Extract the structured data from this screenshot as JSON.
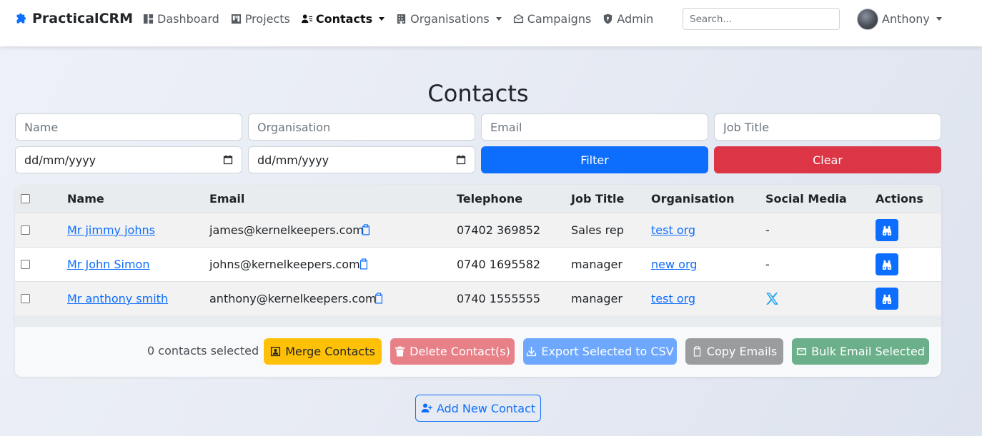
{
  "brand": {
    "name": "PracticalCRM",
    "color": "#0d6efd"
  },
  "nav": {
    "items": [
      {
        "label": "Dashboard",
        "icon": "dashboard-icon",
        "active": false,
        "dropdown": false
      },
      {
        "label": "Projects",
        "icon": "kanban-icon",
        "active": false,
        "dropdown": false
      },
      {
        "label": "Contacts",
        "icon": "contacts-icon",
        "active": true,
        "dropdown": true
      },
      {
        "label": "Organisations",
        "icon": "building-icon",
        "active": false,
        "dropdown": true
      },
      {
        "label": "Campaigns",
        "icon": "envelope-icon",
        "active": false,
        "dropdown": false
      },
      {
        "label": "Admin",
        "icon": "shield-icon",
        "active": false,
        "dropdown": false
      }
    ],
    "search_placeholder": "Search...",
    "user_name": "Anthony"
  },
  "page": {
    "title": "Contacts"
  },
  "filters": {
    "name_placeholder": "Name",
    "organisation_placeholder": "Organisation",
    "email_placeholder": "Email",
    "job_title_placeholder": "Job Title",
    "date_from": "dd/mm/yyyy",
    "date_to": "dd/mm/yyyy",
    "filter_label": "Filter",
    "clear_label": "Clear"
  },
  "table": {
    "headers": [
      "Name",
      "Email",
      "Telephone",
      "Job Title",
      "Organisation",
      "Social Media",
      "Actions"
    ],
    "rows": [
      {
        "name": "Mr jimmy johns",
        "email": "james@kernelkeepers.com",
        "telephone": "07402 369852",
        "job_title": "Sales rep",
        "organisation": "test org",
        "social": "-"
      },
      {
        "name": "Mr John Simon",
        "email": "johns@kernelkeepers.com",
        "telephone": "0740 1695582",
        "job_title": "manager",
        "organisation": "new org",
        "social": "-"
      },
      {
        "name": "Mr anthony smith",
        "email": "anthony@kernelkeepers.com",
        "telephone": "0740 1555555",
        "job_title": "manager",
        "organisation": "test org",
        "social": "x-icon"
      }
    ]
  },
  "bulk": {
    "selected_text": "0 contacts selected",
    "merge_label": "Merge Contacts",
    "delete_label": "Delete Contact(s)",
    "export_label": "Export Selected to CSV",
    "copy_label": "Copy Emails",
    "bulk_email_label": "Bulk Email Selected"
  },
  "add_contact_label": "Add New Contact",
  "colors": {
    "primary": "#0d6efd",
    "danger": "#dc3545",
    "warning": "#ffc107",
    "secondary": "#6c757d",
    "success": "#198754",
    "x_brand": "#1da1f2"
  }
}
